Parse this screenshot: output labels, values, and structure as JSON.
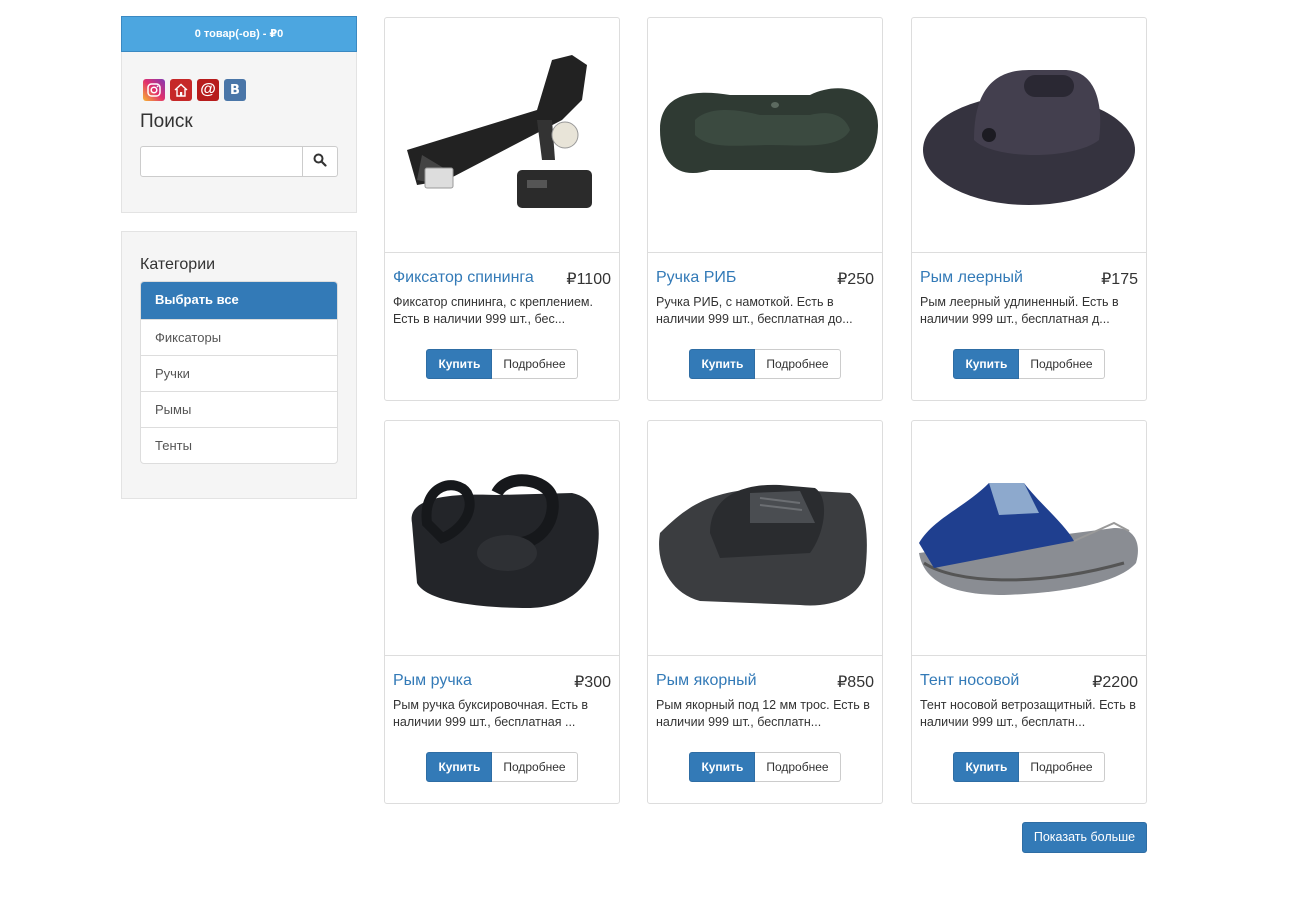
{
  "cart": {
    "label": "0 товар(-ов) - ₽0"
  },
  "socials": [
    {
      "icon": "instagram-icon",
      "color": "#e1306c"
    },
    {
      "icon": "home-icon",
      "color": "#c62828"
    },
    {
      "icon": "mail-at-icon",
      "color": "#b71c1c"
    },
    {
      "icon": "vk-icon",
      "color": "#4a76a8",
      "glyph": "В"
    }
  ],
  "search": {
    "title": "Поиск",
    "value": ""
  },
  "categories": {
    "title": "Категории",
    "items": [
      {
        "label": "Выбрать все",
        "active": true
      },
      {
        "label": "Фиксаторы"
      },
      {
        "label": "Ручки"
      },
      {
        "label": "Рымы"
      },
      {
        "label": "Тенты"
      }
    ]
  },
  "products": [
    {
      "name": "Фиксатор спининга",
      "price": "₽1100",
      "desc": "Фиксатор спининга, с креплением. Есть в наличии 999 шт., бес...",
      "buy": "Купить",
      "more": "Подробнее"
    },
    {
      "name": "Ручка РИБ",
      "price": "₽250",
      "desc": "Ручка РИБ, с намоткой. Есть в наличии 999 шт., бесплатная до...",
      "buy": "Купить",
      "more": "Подробнее"
    },
    {
      "name": "Рым леерный",
      "price": "₽175",
      "desc": "Рым леерный удлиненный. Есть в наличии 999 шт., бесплатная д...",
      "buy": "Купить",
      "more": "Подробнее"
    },
    {
      "name": "Рым ручка",
      "price": "₽300",
      "desc": "Рым ручка буксировочная. Есть в наличии 999 шт., бесплатная ...",
      "buy": "Купить",
      "more": "Подробнее"
    },
    {
      "name": "Рым якорный",
      "price": "₽850",
      "desc": "Рым якорный под 12 мм трос. Есть в наличии 999 шт., бесплатн...",
      "buy": "Купить",
      "more": "Подробнее"
    },
    {
      "name": "Тент носовой",
      "price": "₽2200",
      "desc": "Тент носовой ветрозащитный. Есть в наличии 999 шт., бесплатн...",
      "buy": "Купить",
      "more": "Подробнее"
    }
  ],
  "show_more": "Показать больше"
}
